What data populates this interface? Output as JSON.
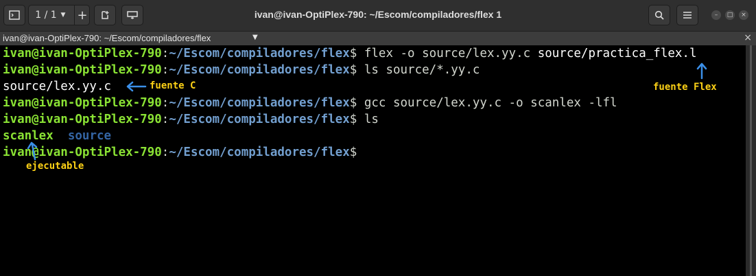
{
  "window": {
    "title": "ivan@ivan-OptiPlex-790: ~/Escom/compiladores/flex 1",
    "tab_counter": "1 / 1",
    "tab_label": "ivan@ivan-OptiPlex-790: ~/Escom/compiladores/flex"
  },
  "terminal": {
    "prompt_user": "ivan@ivan-OptiPlex-790",
    "prompt_sep": ":",
    "prompt_path": "~/Escom/compiladores/flex",
    "prompt_dollar": "$",
    "lines": [
      {
        "cmd": " flex -o source/lex.yy.c ",
        "cmd_hl": "source/practica_flex.l"
      },
      {
        "cmd": " ls source/*.yy.c"
      },
      {
        "output": "source/lex.yy.c"
      },
      {
        "cmd": " gcc source/lex.yy.c -o scanlex -lfl"
      },
      {
        "cmd": " ls"
      },
      {
        "out_exec": "scanlex",
        "out_dir": "  source"
      },
      {
        "cmd": ""
      }
    ]
  },
  "annotations": {
    "fuente_flex": "fuente Flex",
    "fuente_c": "fuente C",
    "ejecutable": "ejecutable"
  },
  "colors": {
    "user": "#8ae234",
    "path": "#729fcf",
    "annotation": "#fcd116",
    "arrow": "#3b8fe8"
  }
}
